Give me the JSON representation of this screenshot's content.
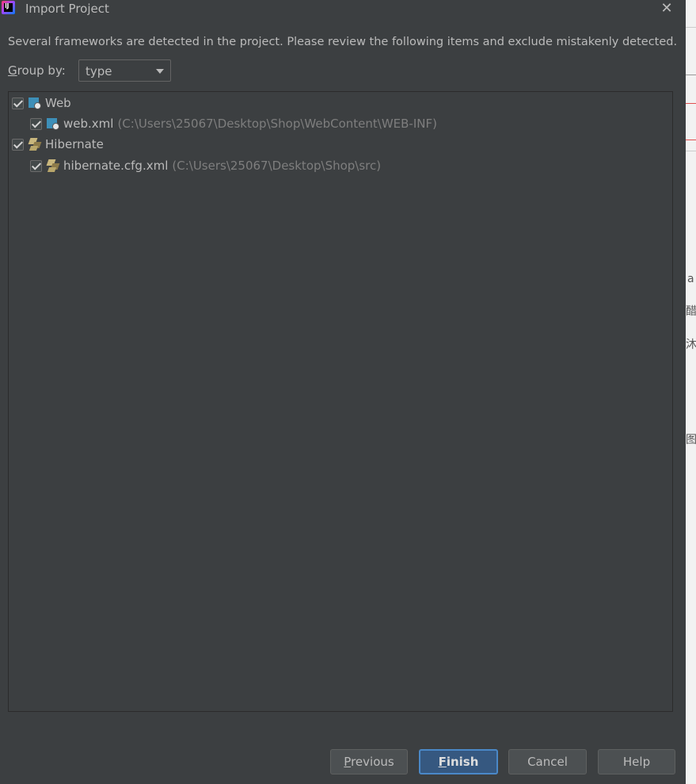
{
  "window": {
    "title": "Import Project",
    "close_icon": "close-icon",
    "app_icon": "intellij-idea-icon",
    "app_icon_text": "IJ"
  },
  "description": "Several frameworks are detected in the project. Please review the following items and exclude mistakenly detected.",
  "group_by": {
    "label_mnemonic": "G",
    "label_rest": "roup by:",
    "value": "type"
  },
  "tree": [
    {
      "label": "Web",
      "checked": true,
      "icon": "web-framework-icon"
    },
    {
      "label": "web.xml",
      "path": "(C:\\Users\\25067\\Desktop\\Shop\\WebContent\\WEB-INF)",
      "checked": true,
      "icon": "web-xml-icon"
    },
    {
      "label": "Hibernate",
      "checked": true,
      "icon": "hibernate-icon"
    },
    {
      "label": "hibernate.cfg.xml",
      "path": "(C:\\Users\\25067\\Desktop\\Shop\\src)",
      "checked": true,
      "icon": "hibernate-cfg-icon"
    }
  ],
  "buttons": {
    "previous_mnemonic": "P",
    "previous_rest": "revious",
    "finish_mnemonic": "F",
    "finish_rest": "inish",
    "cancel": "Cancel",
    "help": "Help"
  },
  "right_strip_glyphs": [
    "a",
    "醋",
    "沐",
    "图"
  ],
  "colors": {
    "dialog_bg": "#3c3f41",
    "text": "#bbbbbb",
    "path_text": "#7e7e7e",
    "primary_button": "#365880",
    "primary_border": "#4a88c7"
  }
}
